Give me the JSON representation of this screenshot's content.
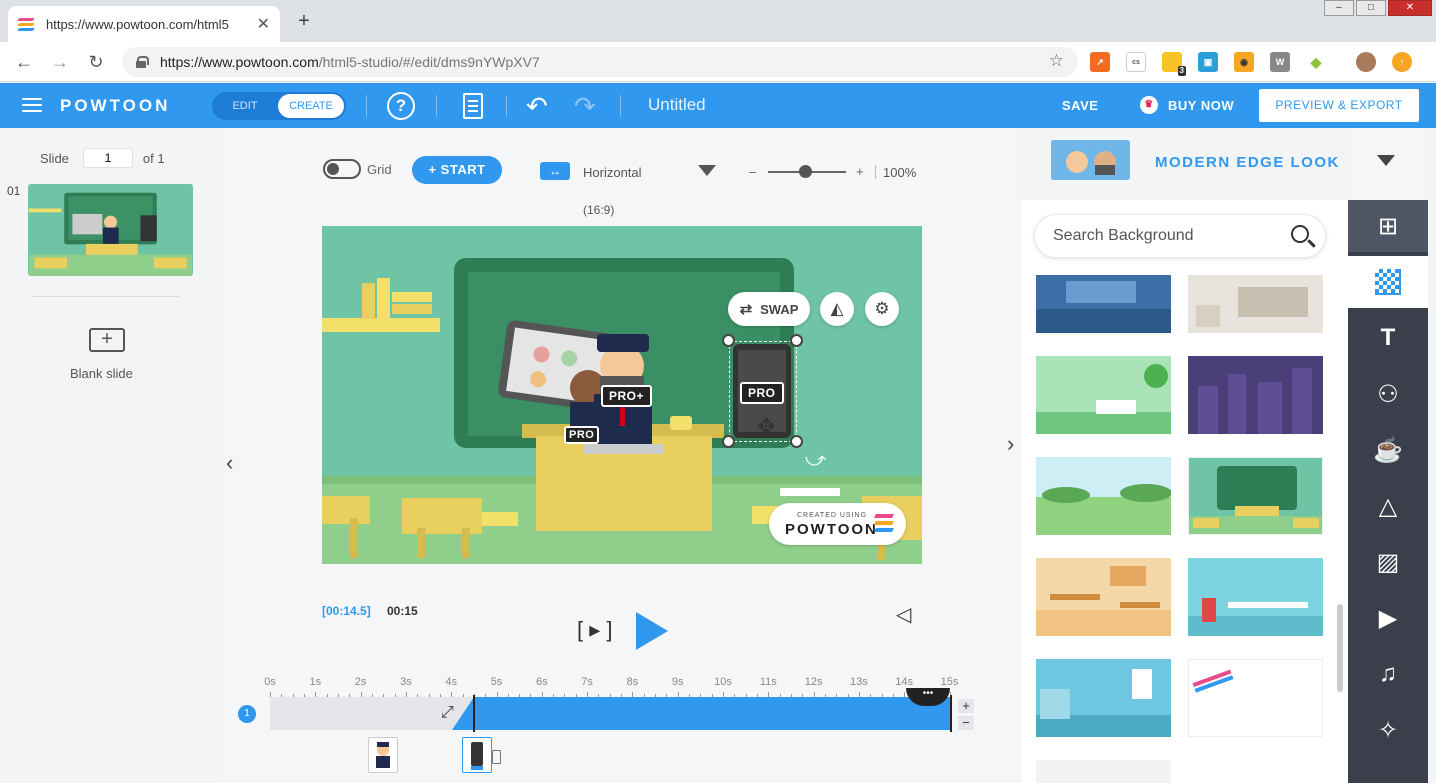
{
  "browser": {
    "tab_title": "https://www.powtoon.com/html5",
    "url_host": "https://www.powtoon.com",
    "url_path": "/html5-studio/#/edit/dms9nYWpXV7",
    "ext_badge": "3"
  },
  "header": {
    "logo": "POWTOON",
    "mode_edit": "EDIT",
    "mode_create": "CREATE",
    "help": "?",
    "doc_title": "Untitled",
    "save": "SAVE",
    "buy_now": "BUY NOW",
    "preview_export": "PREVIEW & EXPORT"
  },
  "slides": {
    "label": "Slide",
    "current": "1",
    "of": "of 1",
    "number": "01",
    "blank_label": "Blank slide"
  },
  "toolbar": {
    "grid_label": "Grid",
    "grid_on": false,
    "start_label": "START",
    "orientation": "Horizontal",
    "ratio": "(16:9)",
    "zoom_minus": "–",
    "zoom_plus": "+",
    "zoom": "100%",
    "zoom_level": 0.5
  },
  "stage": {
    "swap_label": "SWAP",
    "badge_pro": "PRO",
    "badge_proplus": "PRO+",
    "badge_pro_partial": "PRO",
    "watermark_small": "CREATED USING",
    "watermark_big": "POWTOON"
  },
  "playback": {
    "current_time": "[00:14.5]",
    "total_time": "00:15"
  },
  "timeline": {
    "labels": [
      "0s",
      "1s",
      "2s",
      "3s",
      "4s",
      "5s",
      "6s",
      "7s",
      "8s",
      "9s",
      "10s",
      "11s",
      "12s",
      "13s",
      "14s",
      "15s"
    ],
    "layer": "1",
    "zoom_in": "+",
    "zoom_out": "−"
  },
  "right_panel": {
    "style_name": "MODERN EDGE LOOK",
    "search_placeholder": "Search Background"
  },
  "colors": {
    "accent": "#3198f0",
    "stage_bg": "#6ec4a5",
    "rail_bg": "#3a3f4b"
  }
}
